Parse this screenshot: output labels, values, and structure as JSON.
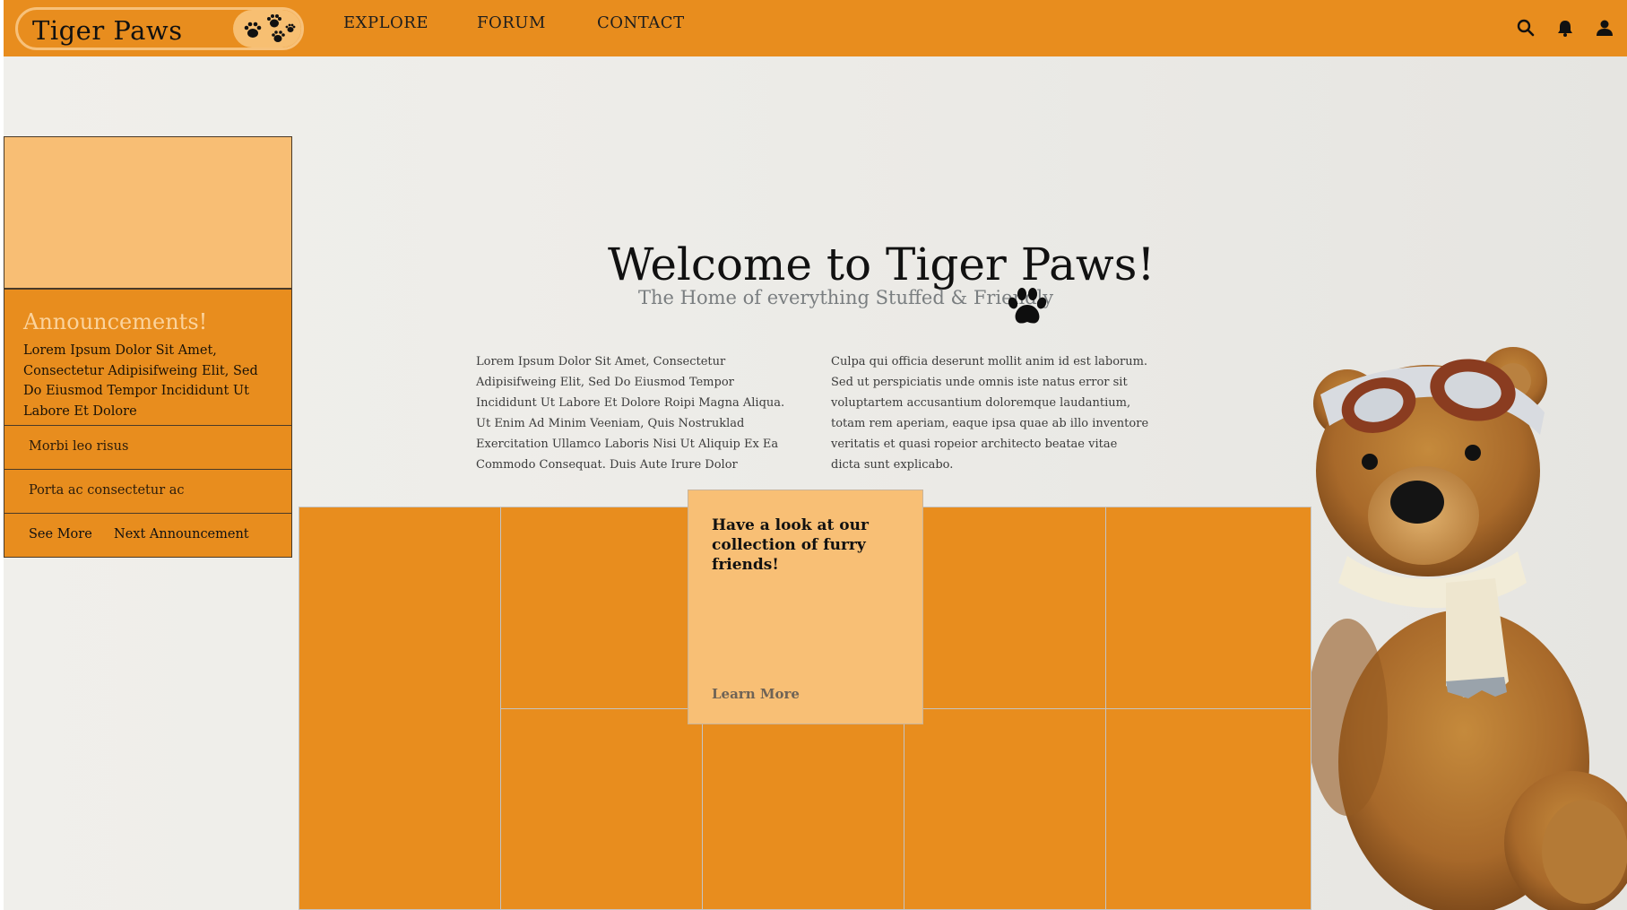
{
  "brand": {
    "name": "Tiger Paws",
    "accent": "#e88d1e",
    "light_accent": "#f8be74"
  },
  "nav": {
    "links": [
      "EXPLORE",
      "FORUM",
      "CONTACT"
    ],
    "icons": [
      "search-icon",
      "bell-icon",
      "user-icon"
    ]
  },
  "sidebar": {
    "announcement_title": "Announcements!",
    "announcement_body": "Lorem Ipsum Dolor Sit Amet, Consectetur Adipisifweing Elit, Sed Do Eiusmod Tempor Incididunt Ut Labore Et Dolore",
    "items": [
      "Morbi leo risus",
      "Porta ac consectetur ac"
    ],
    "actions": {
      "see_more": "See More",
      "next": "Next Announcement"
    }
  },
  "hero": {
    "title": "Welcome to Tiger Paws!",
    "subtitle": "The Home of everything Stuffed & Friendly",
    "col1": "Lorem Ipsum Dolor Sit Amet, Consectetur Adipisifweing Elit, Sed Do Eiusmod Tempor Incididunt Ut Labore Et Dolore Roipi Magna Aliqua. Ut Enim Ad Minim Veeniam, Quis Nostruklad Exercitation Ullamco Laboris Nisi Ut Aliquip Ex Ea Commodo Consequat. Duis Aute Irure Dolor",
    "col2": "Culpa qui officia deserunt mollit anim id est laborum. Sed ut perspiciatis unde omnis iste natus error sit voluptartem accusantium doloremque laudantium, totam rem aperiam, eaque ipsa quae ab illo inventore veritatis et quasi ropeior architecto beatae vitae dicta sunt explicabo."
  },
  "feature": {
    "title": "Have a look at our collection of furry friends!",
    "link": "Learn More"
  }
}
